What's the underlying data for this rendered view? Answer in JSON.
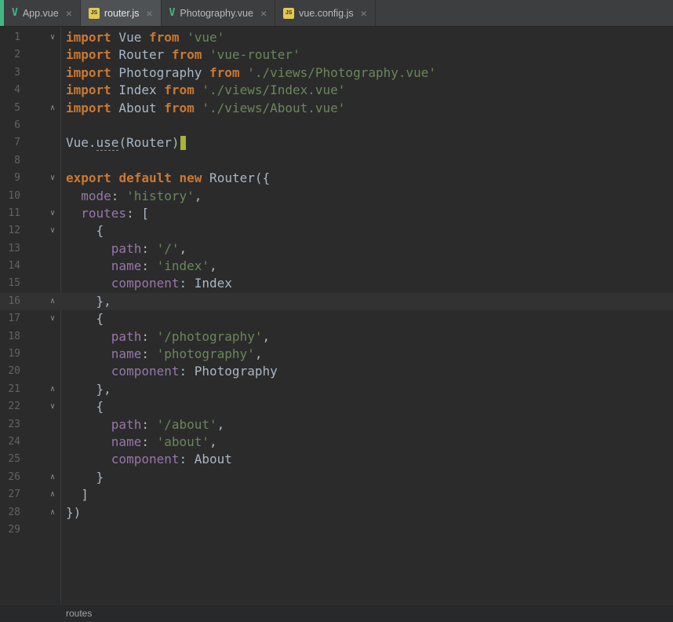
{
  "colors": {
    "background": "#2B2B2B",
    "tab_bar": "#3C3E40",
    "active_tab": "#4E5254",
    "keyword": "#CC7832",
    "string": "#6A8759",
    "property": "#9876AA",
    "plain_text": "#A9B7C6",
    "line_number": "#606366",
    "current_line_highlight": "#323232",
    "caret": "#A6B437",
    "vue_green": "#41B883",
    "js_yellow": "#E2C94F"
  },
  "icons": {
    "close": "×",
    "fold_down": "∨",
    "fold_up": "∧",
    "vue": "V",
    "js": "JS"
  },
  "tabs": [
    {
      "label": "App.vue",
      "icon": "vue",
      "active": false
    },
    {
      "label": "router.js",
      "icon": "js",
      "active": true
    },
    {
      "label": "Photography.vue",
      "icon": "vue",
      "active": false
    },
    {
      "label": "vue.config.js",
      "icon": "js",
      "active": false
    }
  ],
  "breadcrumb": "routes",
  "editor": {
    "lines": [
      {
        "n": 1,
        "fold": "down",
        "tokens": [
          [
            "k",
            "import"
          ],
          [
            "t",
            " Vue "
          ],
          [
            "k",
            "from"
          ],
          [
            "t",
            " "
          ],
          [
            "s",
            "'vue'"
          ]
        ]
      },
      {
        "n": 2,
        "fold": null,
        "tokens": [
          [
            "k",
            "import"
          ],
          [
            "t",
            " Router "
          ],
          [
            "k",
            "from"
          ],
          [
            "t",
            " "
          ],
          [
            "s",
            "'vue-router'"
          ]
        ]
      },
      {
        "n": 3,
        "fold": null,
        "tokens": [
          [
            "k",
            "import"
          ],
          [
            "t",
            " Photography "
          ],
          [
            "k",
            "from"
          ],
          [
            "t",
            " "
          ],
          [
            "s",
            "'./views/Photography.vue'"
          ]
        ]
      },
      {
        "n": 4,
        "fold": null,
        "tokens": [
          [
            "k",
            "import"
          ],
          [
            "t",
            " Index "
          ],
          [
            "k",
            "from"
          ],
          [
            "t",
            " "
          ],
          [
            "s",
            "'./views/Index.vue'"
          ]
        ]
      },
      {
        "n": 5,
        "fold": "up",
        "tokens": [
          [
            "k",
            "import"
          ],
          [
            "t",
            " About "
          ],
          [
            "k",
            "from"
          ],
          [
            "t",
            " "
          ],
          [
            "s",
            "'./views/About.vue'"
          ]
        ]
      },
      {
        "n": 6,
        "fold": null,
        "tokens": []
      },
      {
        "n": 7,
        "fold": null,
        "caret": true,
        "tokens": [
          [
            "t",
            "Vue."
          ],
          [
            "u",
            "use"
          ],
          [
            "t",
            "(Router)"
          ]
        ]
      },
      {
        "n": 8,
        "fold": null,
        "tokens": []
      },
      {
        "n": 9,
        "fold": "down",
        "tokens": [
          [
            "k",
            "export"
          ],
          [
            "t",
            " "
          ],
          [
            "k",
            "default"
          ],
          [
            "t",
            " "
          ],
          [
            "k",
            "new"
          ],
          [
            "t",
            " Router({"
          ]
        ]
      },
      {
        "n": 10,
        "fold": null,
        "tokens": [
          [
            "t",
            "  "
          ],
          [
            "p",
            "mode"
          ],
          [
            "t",
            ": "
          ],
          [
            "s",
            "'history'"
          ],
          [
            "t",
            ","
          ]
        ]
      },
      {
        "n": 11,
        "fold": "down",
        "tokens": [
          [
            "t",
            "  "
          ],
          [
            "p",
            "routes"
          ],
          [
            "t",
            ": ["
          ]
        ]
      },
      {
        "n": 12,
        "fold": "down",
        "tokens": [
          [
            "t",
            "    {"
          ]
        ]
      },
      {
        "n": 13,
        "fold": null,
        "tokens": [
          [
            "t",
            "      "
          ],
          [
            "p",
            "path"
          ],
          [
            "t",
            ": "
          ],
          [
            "s",
            "'/'"
          ],
          [
            "t",
            ","
          ]
        ]
      },
      {
        "n": 14,
        "fold": null,
        "tokens": [
          [
            "t",
            "      "
          ],
          [
            "p",
            "name"
          ],
          [
            "t",
            ": "
          ],
          [
            "s",
            "'index'"
          ],
          [
            "t",
            ","
          ]
        ]
      },
      {
        "n": 15,
        "fold": null,
        "tokens": [
          [
            "t",
            "      "
          ],
          [
            "p",
            "component"
          ],
          [
            "t",
            ": Index"
          ]
        ]
      },
      {
        "n": 16,
        "fold": "up",
        "current": true,
        "tokens": [
          [
            "t",
            "    },"
          ]
        ]
      },
      {
        "n": 17,
        "fold": "down",
        "tokens": [
          [
            "t",
            "    {"
          ]
        ]
      },
      {
        "n": 18,
        "fold": null,
        "tokens": [
          [
            "t",
            "      "
          ],
          [
            "p",
            "path"
          ],
          [
            "t",
            ": "
          ],
          [
            "s",
            "'/photography'"
          ],
          [
            "t",
            ","
          ]
        ]
      },
      {
        "n": 19,
        "fold": null,
        "tokens": [
          [
            "t",
            "      "
          ],
          [
            "p",
            "name"
          ],
          [
            "t",
            ": "
          ],
          [
            "s",
            "'photography'"
          ],
          [
            "t",
            ","
          ]
        ]
      },
      {
        "n": 20,
        "fold": null,
        "tokens": [
          [
            "t",
            "      "
          ],
          [
            "p",
            "component"
          ],
          [
            "t",
            ": Photography"
          ]
        ]
      },
      {
        "n": 21,
        "fold": "up",
        "tokens": [
          [
            "t",
            "    },"
          ]
        ]
      },
      {
        "n": 22,
        "fold": "down",
        "tokens": [
          [
            "t",
            "    {"
          ]
        ]
      },
      {
        "n": 23,
        "fold": null,
        "tokens": [
          [
            "t",
            "      "
          ],
          [
            "p",
            "path"
          ],
          [
            "t",
            ": "
          ],
          [
            "s",
            "'/about'"
          ],
          [
            "t",
            ","
          ]
        ]
      },
      {
        "n": 24,
        "fold": null,
        "tokens": [
          [
            "t",
            "      "
          ],
          [
            "p",
            "name"
          ],
          [
            "t",
            ": "
          ],
          [
            "s",
            "'about'"
          ],
          [
            "t",
            ","
          ]
        ]
      },
      {
        "n": 25,
        "fold": null,
        "tokens": [
          [
            "t",
            "      "
          ],
          [
            "p",
            "component"
          ],
          [
            "t",
            ": About"
          ]
        ]
      },
      {
        "n": 26,
        "fold": "up",
        "tokens": [
          [
            "t",
            "    }"
          ]
        ]
      },
      {
        "n": 27,
        "fold": "up",
        "tokens": [
          [
            "t",
            "  ]"
          ]
        ]
      },
      {
        "n": 28,
        "fold": "up",
        "tokens": [
          [
            "t",
            "})"
          ]
        ]
      },
      {
        "n": 29,
        "fold": null,
        "tokens": []
      }
    ]
  }
}
